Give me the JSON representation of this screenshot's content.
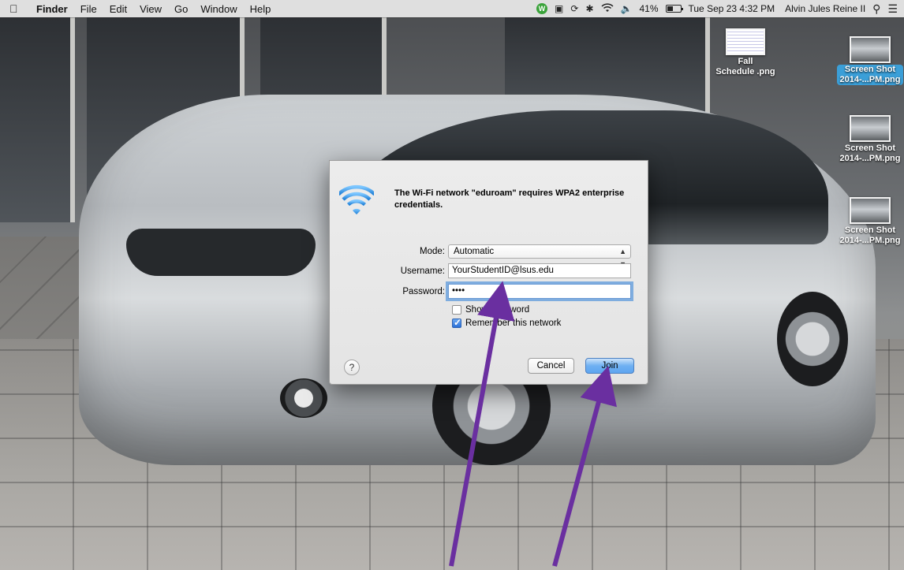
{
  "menubar": {
    "app_name": "Finder",
    "menus": [
      "File",
      "Edit",
      "View",
      "Go",
      "Window",
      "Help"
    ],
    "w_badge": "W",
    "battery_percent": "41%",
    "datetime": "Tue Sep 23  4:32 PM",
    "user_name": "Alvin Jules Reine II"
  },
  "desktop_files": [
    {
      "line1": "Fall",
      "line2": "Schedule .png",
      "selected": false,
      "thumb": "document"
    },
    {
      "line1": "Screen Shot",
      "line2": "2014-...PM.png",
      "selected": true,
      "thumb": "car-photo"
    },
    {
      "line1": "Screen Shot",
      "line2": "2014-...PM.png",
      "selected": false,
      "thumb": "car-photo"
    },
    {
      "line1": "Screen Shot",
      "line2": "2014-...PM.png",
      "selected": false,
      "thumb": "car-photo"
    }
  ],
  "dialog": {
    "icon": "wifi-icon",
    "message": "The Wi-Fi network \"eduroam\" requires WPA2 enterprise credentials.",
    "mode_label": "Mode:",
    "mode_value": "Automatic",
    "username_label": "Username:",
    "username_value": "YourStudentID@lsus.edu",
    "password_label": "Password:",
    "password_value": "••••",
    "show_password_label": "Show password",
    "show_password_checked": false,
    "remember_label": "Remember this network",
    "remember_checked": true,
    "help_label": "?",
    "cancel_label": "Cancel",
    "join_label": "Join"
  },
  "colors": {
    "annotation_arrow": "#6a2fa0",
    "selection_blue": "#3b9fd8",
    "focus_ring": "#5c9adc",
    "wifi_blue": "#3d9be9"
  }
}
